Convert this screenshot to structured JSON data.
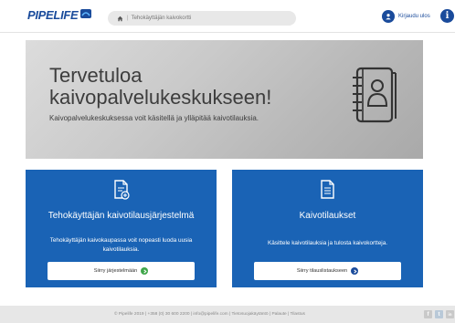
{
  "header": {
    "logo_text": "PIPELIFE",
    "breadcrumb": "Tehokäyttäjän kaivokortti",
    "login_label": "Kirjaudu ulos",
    "info_label": "i"
  },
  "hero": {
    "title_line1": "Tervetuloa",
    "title_line2": "kaivopalvelukeskukseen!",
    "subtitle": "Kaivopalvelukeskuksessa voit käsitellä ja ylläpitää kaivotilauksia."
  },
  "cards": [
    {
      "title": "Tehokäyttäjän kaivotilausjärjestelmä",
      "description": "Tehokäyttäjän kaivokaupassa voit nopeasti luoda uusia kaivotilauksia.",
      "button_label": "Siirry järjestelmään"
    },
    {
      "title": "Kaivotilaukset",
      "description": "Käsittele kaivotilauksia ja tulosta kaivokortteja.",
      "button_label": "Siirry tilauslistaukseen"
    }
  ],
  "footer": {
    "text": "© Pipelife 2019  |  +358 (0) 30 600 2200  |  info@pipelife.com  |  Tietosuojakäytäntö  |  Palaute  |  Tilastus",
    "social": [
      "f",
      "t",
      "in"
    ]
  },
  "colors": {
    "brand": "#1a4b9b",
    "card": "#1a63b5",
    "go_green": "#3fa64a"
  }
}
